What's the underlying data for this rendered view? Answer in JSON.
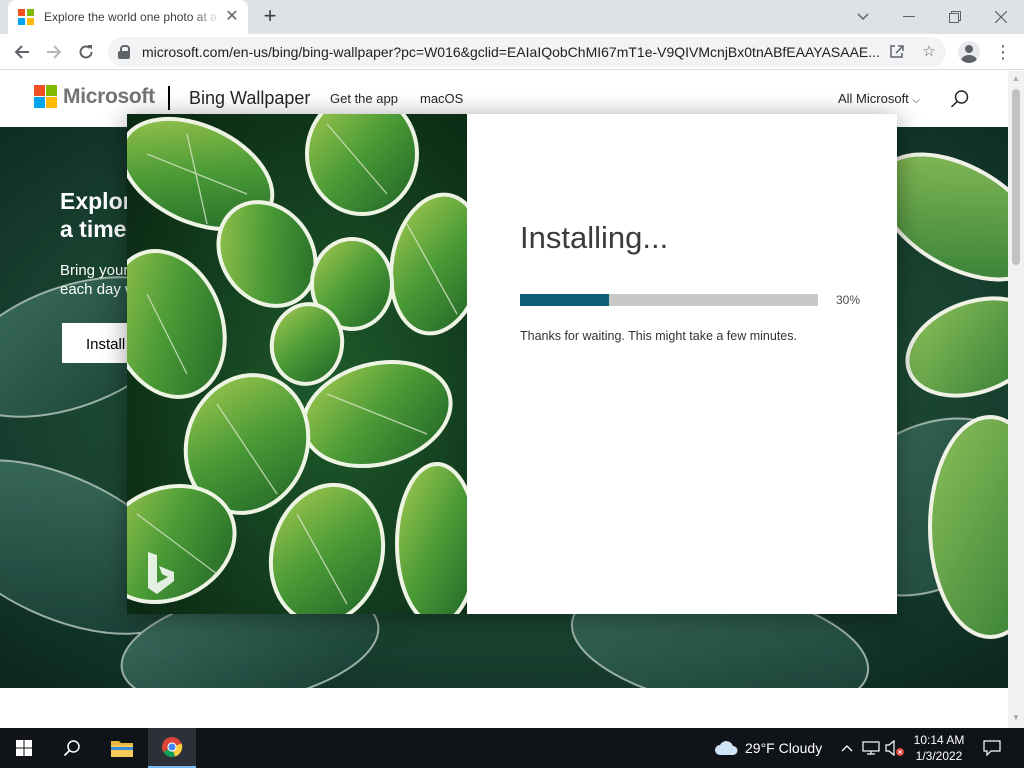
{
  "browser": {
    "tab_title": "Explore the world one photo at a time",
    "url": "microsoft.com/en-us/bing/bing-wallpaper?pc=W016&gclid=EAIaIQobChMI67mT1e-V9QIVMcnjBx0tnABfEAAYASAAE..."
  },
  "header": {
    "brand": "Microsoft",
    "product": "Bing Wallpaper",
    "nav": [
      "Get the app",
      "macOS"
    ],
    "all_microsoft": "All Microsoft"
  },
  "hero": {
    "title_line1": "Explor",
    "title_line2": "a time",
    "sub_line1": "Bring your",
    "sub_line2": "each day w",
    "button": "Install"
  },
  "modal": {
    "title": "Installing...",
    "progress_percent": 30,
    "progress_label": "30%",
    "message": "Thanks for waiting. This might take a few minutes."
  },
  "taskbar": {
    "weather": "29°F  Cloudy",
    "time": "10:14 AM",
    "date": "1/3/2022"
  },
  "colors": {
    "accent": "#0e5f7a",
    "ms_red": "#f25022",
    "ms_green": "#7fba00",
    "ms_blue": "#00a4ef",
    "ms_yellow": "#ffb900"
  }
}
